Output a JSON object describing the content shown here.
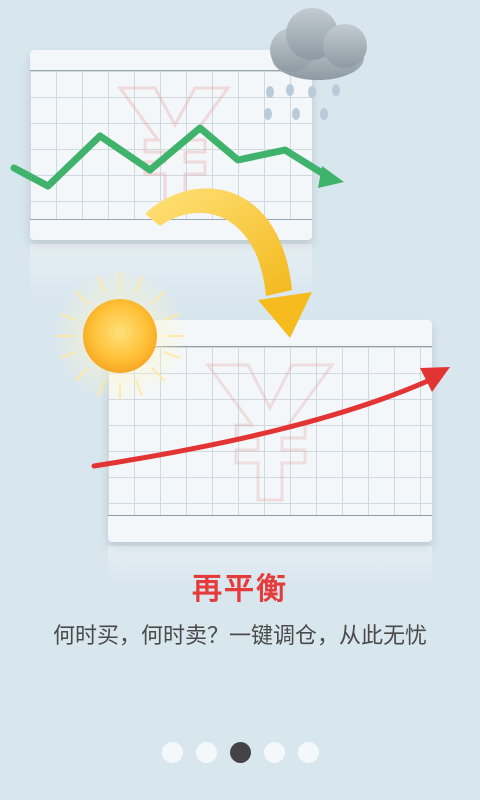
{
  "onboarding": {
    "title": "再平衡",
    "subtitle": "何时买，何时卖？一键调仓，从此无忧",
    "page_indicator": {
      "total": 5,
      "active_index": 2
    }
  },
  "illustration": {
    "icons": [
      "rain-cloud-icon",
      "sun-icon",
      "yuan-symbol-icon",
      "trend-down-arrow-icon",
      "trend-up-arrow-icon",
      "curved-arrow-icon"
    ],
    "colors": {
      "title": "#e63b3b",
      "green_line": "#3fb36b",
      "red_line": "#e33434",
      "sun": "#ffc23f",
      "arrow": "#f6c026",
      "background": "#d8e6ee"
    }
  }
}
